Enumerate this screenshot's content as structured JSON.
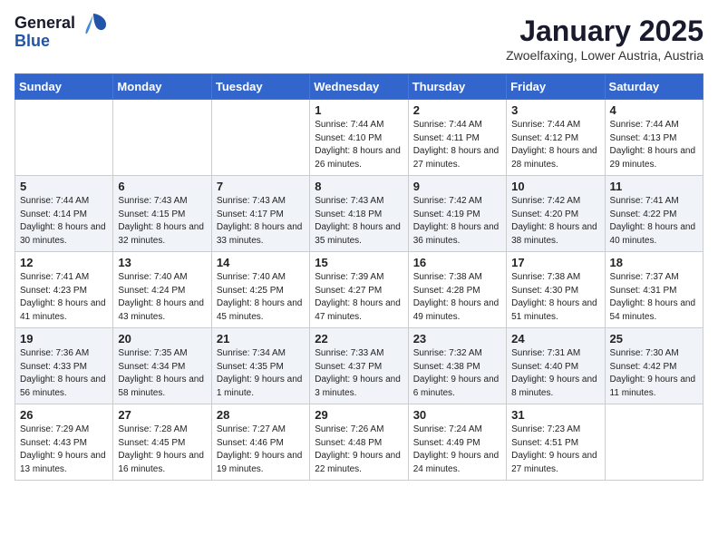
{
  "logo": {
    "general": "General",
    "blue": "Blue"
  },
  "title": "January 2025",
  "location": "Zwoelfaxing, Lower Austria, Austria",
  "weekdays": [
    "Sunday",
    "Monday",
    "Tuesday",
    "Wednesday",
    "Thursday",
    "Friday",
    "Saturday"
  ],
  "weeks": [
    [
      {
        "day": "",
        "info": ""
      },
      {
        "day": "",
        "info": ""
      },
      {
        "day": "",
        "info": ""
      },
      {
        "day": "1",
        "info": "Sunrise: 7:44 AM\nSunset: 4:10 PM\nDaylight: 8 hours and 26 minutes."
      },
      {
        "day": "2",
        "info": "Sunrise: 7:44 AM\nSunset: 4:11 PM\nDaylight: 8 hours and 27 minutes."
      },
      {
        "day": "3",
        "info": "Sunrise: 7:44 AM\nSunset: 4:12 PM\nDaylight: 8 hours and 28 minutes."
      },
      {
        "day": "4",
        "info": "Sunrise: 7:44 AM\nSunset: 4:13 PM\nDaylight: 8 hours and 29 minutes."
      }
    ],
    [
      {
        "day": "5",
        "info": "Sunrise: 7:44 AM\nSunset: 4:14 PM\nDaylight: 8 hours and 30 minutes."
      },
      {
        "day": "6",
        "info": "Sunrise: 7:43 AM\nSunset: 4:15 PM\nDaylight: 8 hours and 32 minutes."
      },
      {
        "day": "7",
        "info": "Sunrise: 7:43 AM\nSunset: 4:17 PM\nDaylight: 8 hours and 33 minutes."
      },
      {
        "day": "8",
        "info": "Sunrise: 7:43 AM\nSunset: 4:18 PM\nDaylight: 8 hours and 35 minutes."
      },
      {
        "day": "9",
        "info": "Sunrise: 7:42 AM\nSunset: 4:19 PM\nDaylight: 8 hours and 36 minutes."
      },
      {
        "day": "10",
        "info": "Sunrise: 7:42 AM\nSunset: 4:20 PM\nDaylight: 8 hours and 38 minutes."
      },
      {
        "day": "11",
        "info": "Sunrise: 7:41 AM\nSunset: 4:22 PM\nDaylight: 8 hours and 40 minutes."
      }
    ],
    [
      {
        "day": "12",
        "info": "Sunrise: 7:41 AM\nSunset: 4:23 PM\nDaylight: 8 hours and 41 minutes."
      },
      {
        "day": "13",
        "info": "Sunrise: 7:40 AM\nSunset: 4:24 PM\nDaylight: 8 hours and 43 minutes."
      },
      {
        "day": "14",
        "info": "Sunrise: 7:40 AM\nSunset: 4:25 PM\nDaylight: 8 hours and 45 minutes."
      },
      {
        "day": "15",
        "info": "Sunrise: 7:39 AM\nSunset: 4:27 PM\nDaylight: 8 hours and 47 minutes."
      },
      {
        "day": "16",
        "info": "Sunrise: 7:38 AM\nSunset: 4:28 PM\nDaylight: 8 hours and 49 minutes."
      },
      {
        "day": "17",
        "info": "Sunrise: 7:38 AM\nSunset: 4:30 PM\nDaylight: 8 hours and 51 minutes."
      },
      {
        "day": "18",
        "info": "Sunrise: 7:37 AM\nSunset: 4:31 PM\nDaylight: 8 hours and 54 minutes."
      }
    ],
    [
      {
        "day": "19",
        "info": "Sunrise: 7:36 AM\nSunset: 4:33 PM\nDaylight: 8 hours and 56 minutes."
      },
      {
        "day": "20",
        "info": "Sunrise: 7:35 AM\nSunset: 4:34 PM\nDaylight: 8 hours and 58 minutes."
      },
      {
        "day": "21",
        "info": "Sunrise: 7:34 AM\nSunset: 4:35 PM\nDaylight: 9 hours and 1 minute."
      },
      {
        "day": "22",
        "info": "Sunrise: 7:33 AM\nSunset: 4:37 PM\nDaylight: 9 hours and 3 minutes."
      },
      {
        "day": "23",
        "info": "Sunrise: 7:32 AM\nSunset: 4:38 PM\nDaylight: 9 hours and 6 minutes."
      },
      {
        "day": "24",
        "info": "Sunrise: 7:31 AM\nSunset: 4:40 PM\nDaylight: 9 hours and 8 minutes."
      },
      {
        "day": "25",
        "info": "Sunrise: 7:30 AM\nSunset: 4:42 PM\nDaylight: 9 hours and 11 minutes."
      }
    ],
    [
      {
        "day": "26",
        "info": "Sunrise: 7:29 AM\nSunset: 4:43 PM\nDaylight: 9 hours and 13 minutes."
      },
      {
        "day": "27",
        "info": "Sunrise: 7:28 AM\nSunset: 4:45 PM\nDaylight: 9 hours and 16 minutes."
      },
      {
        "day": "28",
        "info": "Sunrise: 7:27 AM\nSunset: 4:46 PM\nDaylight: 9 hours and 19 minutes."
      },
      {
        "day": "29",
        "info": "Sunrise: 7:26 AM\nSunset: 4:48 PM\nDaylight: 9 hours and 22 minutes."
      },
      {
        "day": "30",
        "info": "Sunrise: 7:24 AM\nSunset: 4:49 PM\nDaylight: 9 hours and 24 minutes."
      },
      {
        "day": "31",
        "info": "Sunrise: 7:23 AM\nSunset: 4:51 PM\nDaylight: 9 hours and 27 minutes."
      },
      {
        "day": "",
        "info": ""
      }
    ]
  ]
}
